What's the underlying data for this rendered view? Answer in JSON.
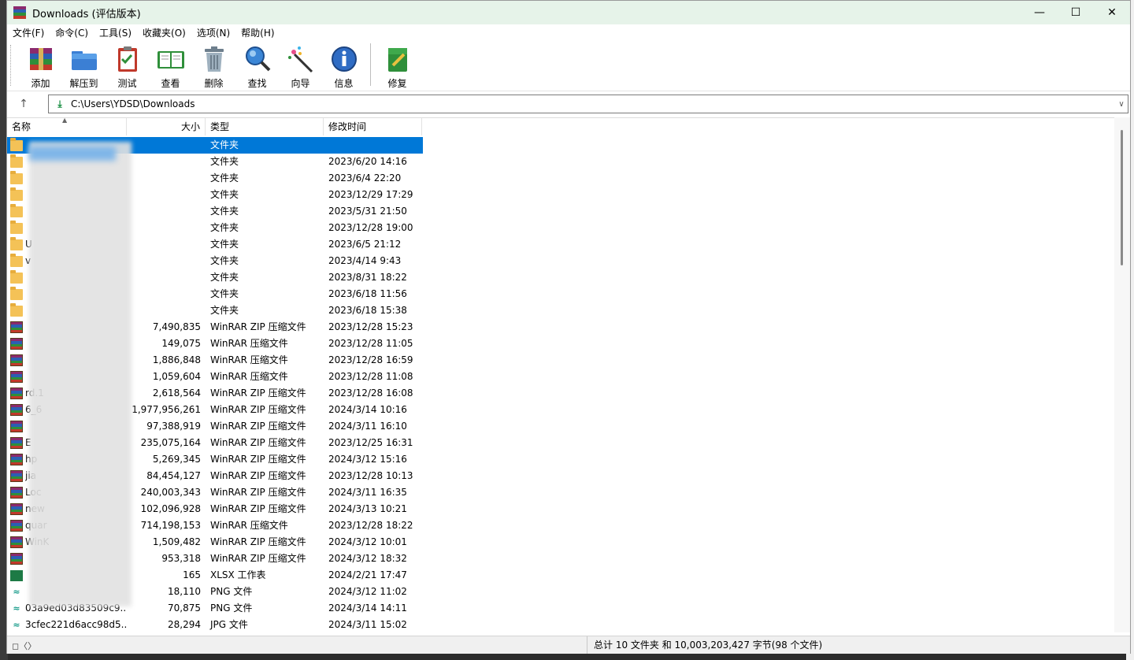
{
  "window": {
    "title": "Downloads (评估版本)"
  },
  "menu": [
    "文件(F)",
    "命令(C)",
    "工具(S)",
    "收藏夹(O)",
    "选项(N)",
    "帮助(H)"
  ],
  "toolbar": {
    "add": "添加",
    "extract": "解压到",
    "test": "测试",
    "view": "查看",
    "delete": "删除",
    "find": "查找",
    "wizard": "向导",
    "info": "信息",
    "repair": "修复"
  },
  "address": {
    "path": "C:\\Users\\YDSD\\Downloads"
  },
  "columns": {
    "name": "名称",
    "size": "大小",
    "type": "类型",
    "modified": "修改时间"
  },
  "rows": [
    {
      "icon": "folder-icon",
      "name": "",
      "size": "",
      "type": "文件夹",
      "modified": ""
    },
    {
      "icon": "folder-icon",
      "name": "",
      "size": "",
      "type": "文件夹",
      "modified": "2023/6/20 14:16"
    },
    {
      "icon": "folder-icon",
      "name": "",
      "size": "",
      "type": "文件夹",
      "modified": "2023/6/4 22:20"
    },
    {
      "icon": "folder-icon",
      "name": "",
      "size": "",
      "type": "文件夹",
      "modified": "2023/12/29 17:29"
    },
    {
      "icon": "folder-icon",
      "name": "",
      "size": "",
      "type": "文件夹",
      "modified": "2023/5/31 21:50"
    },
    {
      "icon": "folder-icon",
      "name": "",
      "size": "",
      "type": "文件夹",
      "modified": "2023/12/28 19:00"
    },
    {
      "icon": "folder-icon",
      "name": "U",
      "size": "",
      "type": "文件夹",
      "modified": "2023/6/5 21:12"
    },
    {
      "icon": "folder-icon",
      "name": "v",
      "size": "",
      "type": "文件夹",
      "modified": "2023/4/14 9:43"
    },
    {
      "icon": "folder-icon",
      "name": "",
      "size": "",
      "type": "文件夹",
      "modified": "2023/8/31 18:22"
    },
    {
      "icon": "folder-icon",
      "name": "",
      "size": "",
      "type": "文件夹",
      "modified": "2023/6/18 11:56"
    },
    {
      "icon": "folder-icon",
      "name": "",
      "size": "",
      "type": "文件夹",
      "modified": "2023/6/18 15:38"
    },
    {
      "icon": "winrar-archive-icon",
      "name": "",
      "size": "7,490,835",
      "type": "WinRAR ZIP 压缩文件",
      "modified": "2023/12/28 15:23"
    },
    {
      "icon": "winrar-archive-icon",
      "name": "",
      "size": "149,075",
      "type": "WinRAR 压缩文件",
      "modified": "2023/12/28 11:05"
    },
    {
      "icon": "winrar-archive-icon",
      "name": "",
      "size": "1,886,848",
      "type": "WinRAR 压缩文件",
      "modified": "2023/12/28 16:59"
    },
    {
      "icon": "winrar-archive-icon",
      "name": "",
      "size": "1,059,604",
      "type": "WinRAR 压缩文件",
      "modified": "2023/12/28 11:08"
    },
    {
      "icon": "winrar-archive-icon",
      "name": "rd.1",
      "size": "2,618,564",
      "type": "WinRAR ZIP 压缩文件",
      "modified": "2023/12/28 16:08"
    },
    {
      "icon": "winrar-archive-icon",
      "name": "6_6",
      "size": "1,977,956,261",
      "type": "WinRAR ZIP 压缩文件",
      "modified": "2024/3/14 10:16"
    },
    {
      "icon": "winrar-archive-icon",
      "name": "",
      "size": "97,388,919",
      "type": "WinRAR ZIP 压缩文件",
      "modified": "2024/3/11 16:10"
    },
    {
      "icon": "winrar-archive-icon",
      "name": "E",
      "size": "235,075,164",
      "type": "WinRAR ZIP 压缩文件",
      "modified": "2023/12/25 16:31"
    },
    {
      "icon": "winrar-archive-icon",
      "name": "hp",
      "size": "5,269,345",
      "type": "WinRAR ZIP 压缩文件",
      "modified": "2024/3/12 15:16"
    },
    {
      "icon": "winrar-archive-icon",
      "name": "jia",
      "size": "84,454,127",
      "type": "WinRAR ZIP 压缩文件",
      "modified": "2023/12/28 10:13"
    },
    {
      "icon": "winrar-archive-icon",
      "name": "Loc",
      "size": "240,003,343",
      "type": "WinRAR ZIP 压缩文件",
      "modified": "2024/3/11 16:35"
    },
    {
      "icon": "winrar-archive-icon",
      "name": "new",
      "size": "102,096,928",
      "type": "WinRAR ZIP 压缩文件",
      "modified": "2024/3/13 10:21"
    },
    {
      "icon": "winrar-archive-icon",
      "name": "quar",
      "size": "714,198,153",
      "type": "WinRAR 压缩文件",
      "modified": "2023/12/28 18:22"
    },
    {
      "icon": "winrar-archive-icon",
      "name": "WinK",
      "size": "1,509,482",
      "type": "WinRAR ZIP 压缩文件",
      "modified": "2024/3/12 10:01"
    },
    {
      "icon": "winrar-archive-icon",
      "name": "",
      "size": "953,318",
      "type": "WinRAR ZIP 压缩文件",
      "modified": "2024/3/12 18:32"
    },
    {
      "icon": "xlsx-icon",
      "name": "",
      "size": "165",
      "type": "XLSX 工作表",
      "modified": "2024/2/21 17:47"
    },
    {
      "icon": "image-icon",
      "name": "",
      "size": "18,110",
      "type": "PNG 文件",
      "modified": "2024/3/12 11:02"
    },
    {
      "icon": "image-icon",
      "name": "03a9ed03d83509c9...",
      "size": "70,875",
      "type": "PNG 文件",
      "modified": "2024/3/14 14:11"
    },
    {
      "icon": "image-icon",
      "name": "3cfec221d6acc98d5...",
      "size": "28,294",
      "type": "JPG 文件",
      "modified": "2024/3/11 15:02"
    }
  ],
  "status": {
    "summary": "总计 10 文件夹 和 10,003,203,427 字节(98 个文件)"
  },
  "colors": {
    "selection": "#0078d7",
    "titlebar": "#e6f3e9"
  }
}
